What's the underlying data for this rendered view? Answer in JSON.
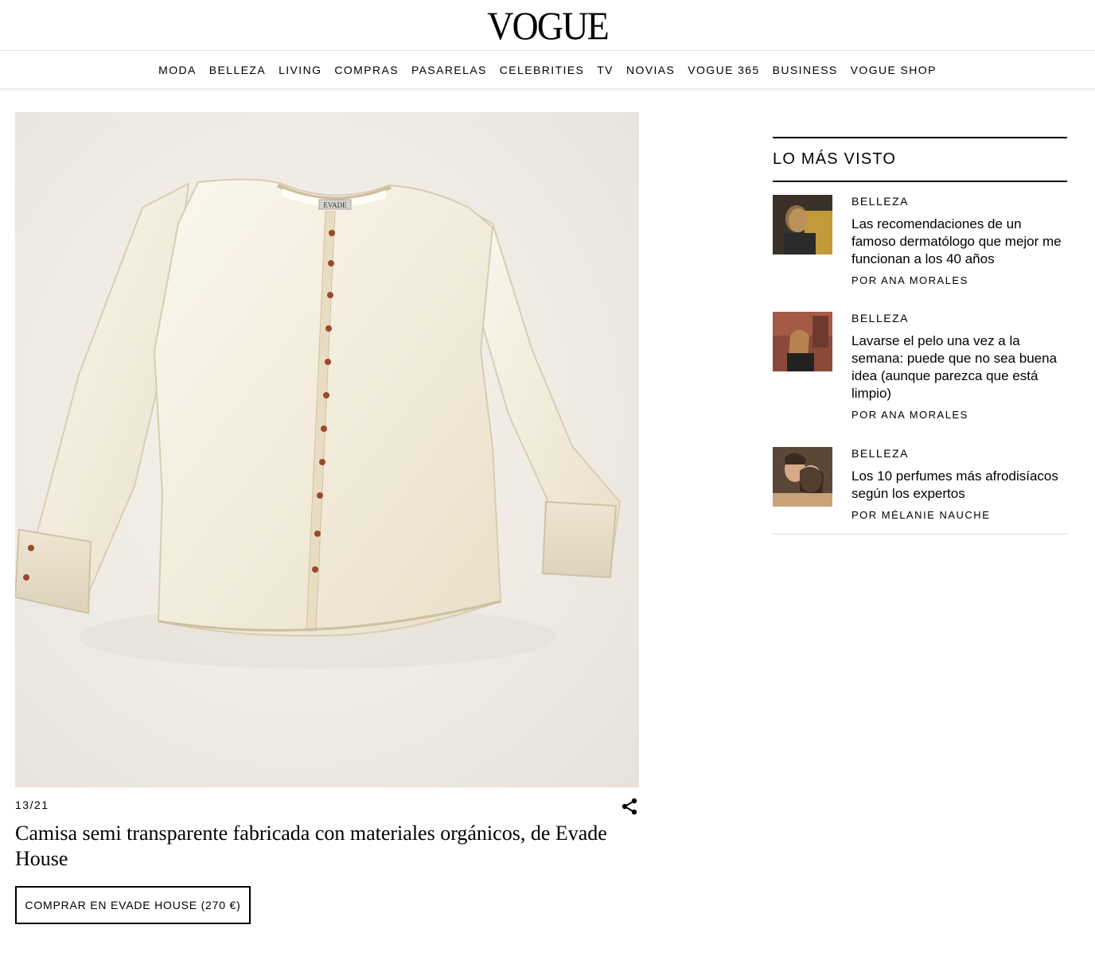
{
  "header": {
    "logo": "VOGUE"
  },
  "nav": [
    "MODA",
    "BELLEZA",
    "LIVING",
    "COMPRAS",
    "PASARELAS",
    "CELEBRITIES",
    "TV",
    "NOVIAS",
    "VOGUE 365",
    "BUSINESS",
    "VOGUE SHOP"
  ],
  "gallery": {
    "counter": "13/21",
    "caption": "Camisa semi transparente fabricada con materiales orgánicos, de Evade House",
    "buy_label": "COMPRAR EN EVADE HOUSE (270 €)",
    "label_tag": "EVADE",
    "share_icon": "share-icon"
  },
  "sidebar": {
    "heading": "LO MÁS VISTO",
    "items": [
      {
        "category": "BELLEZA",
        "title": "Las recomendaciones de un famoso dermatólogo que mejor me funcionan a los 40 años",
        "author": "POR ANA MORALES"
      },
      {
        "category": "BELLEZA",
        "title": "Lavarse el pelo una vez a la semana: puede que no sea buena idea (aunque parezca que está limpio)",
        "author": "POR ANA MORALES"
      },
      {
        "category": "BELLEZA",
        "title": "Los 10 perfumes más afrodisíacos según los expertos",
        "author": "POR MÉLANIE NAUCHE"
      }
    ]
  }
}
